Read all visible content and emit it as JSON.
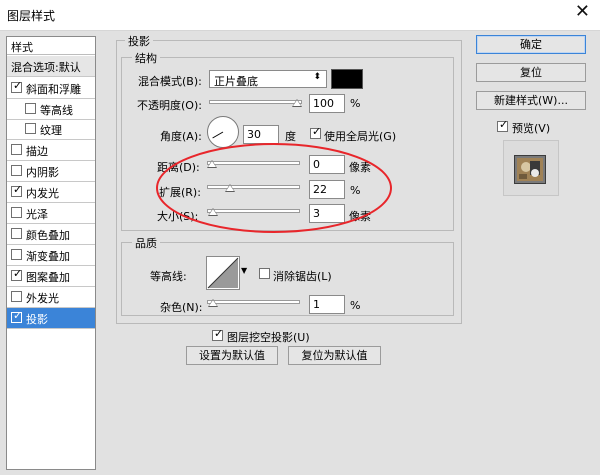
{
  "window": {
    "title": "图层样式",
    "close_glyph": "✕"
  },
  "sidebar": {
    "header": "样式",
    "items": [
      {
        "label": "混合选项:默认",
        "checkbox": false,
        "checked": false,
        "indent": 0,
        "selected": false
      },
      {
        "label": "斜面和浮雕",
        "checkbox": true,
        "checked": true,
        "indent": 0,
        "selected": false
      },
      {
        "label": "等高线",
        "checkbox": true,
        "checked": false,
        "indent": 1,
        "selected": false
      },
      {
        "label": "纹理",
        "checkbox": true,
        "checked": false,
        "indent": 1,
        "selected": false
      },
      {
        "label": "描边",
        "checkbox": true,
        "checked": false,
        "indent": 0,
        "selected": false
      },
      {
        "label": "内阴影",
        "checkbox": true,
        "checked": false,
        "indent": 0,
        "selected": false
      },
      {
        "label": "内发光",
        "checkbox": true,
        "checked": true,
        "indent": 0,
        "selected": false
      },
      {
        "label": "光泽",
        "checkbox": true,
        "checked": false,
        "indent": 0,
        "selected": false
      },
      {
        "label": "颜色叠加",
        "checkbox": true,
        "checked": false,
        "indent": 0,
        "selected": false
      },
      {
        "label": "渐变叠加",
        "checkbox": true,
        "checked": false,
        "indent": 0,
        "selected": false
      },
      {
        "label": "图案叠加",
        "checkbox": true,
        "checked": true,
        "indent": 0,
        "selected": false
      },
      {
        "label": "外发光",
        "checkbox": true,
        "checked": false,
        "indent": 0,
        "selected": false
      },
      {
        "label": "投影",
        "checkbox": true,
        "checked": true,
        "indent": 0,
        "selected": true
      }
    ]
  },
  "drop_shadow": {
    "title": "投影",
    "structure": {
      "title": "结构",
      "blend_mode_label": "混合模式(B):",
      "blend_mode_value": "正片叠底",
      "shadow_color": "#000000",
      "opacity_label": "不透明度(O):",
      "opacity_value": "100",
      "opacity_fraction": 1.0,
      "percent": "%",
      "angle_label": "角度(A):",
      "angle_value": "30",
      "angle_unit": "度",
      "global_light_label": "使用全局光(G)",
      "global_light_checked": true,
      "distance_label": "距离(D):",
      "distance_value": "0",
      "distance_fraction": 0.0,
      "px_unit": "像素",
      "spread_label": "扩展(R):",
      "spread_value": "22",
      "spread_fraction": 0.22,
      "size_label": "大小(S):",
      "size_value": "3",
      "size_fraction": 0.01
    },
    "quality": {
      "title": "品质",
      "contour_label": "等高线:",
      "antialias_label": "消除锯齿(L)",
      "antialias_checked": false,
      "noise_label": "杂色(N):",
      "noise_value": "1",
      "noise_fraction": 0.01,
      "percent": "%"
    },
    "knockout_label": "图层挖空投影(U)",
    "knockout_checked": true,
    "make_default": "设置为默认值",
    "reset_default": "复位为默认值"
  },
  "buttons": {
    "ok": "确定",
    "reset": "复位",
    "new_style": "新建样式(W)...",
    "preview_label": "预览(V)",
    "preview_checked": true
  },
  "annotation_color": "#e8262b",
  "selection_color": "#3b84d8"
}
